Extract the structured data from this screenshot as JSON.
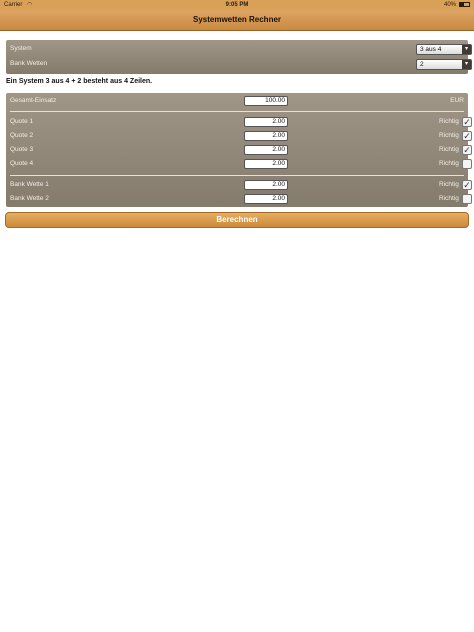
{
  "status_bar": {
    "carrier": "Carrier",
    "time": "9:05 PM",
    "battery": "40%",
    "battery_level": 0.4
  },
  "nav": {
    "title": "Systemwetten Rechner"
  },
  "settings": {
    "system_label": "System",
    "system_value": "3 aus 4",
    "bank_label": "Bank Wetten",
    "bank_value": "2"
  },
  "info_text": "Ein System 3 aus 4 + 2 besteht aus 4 Zeilen.",
  "stake": {
    "label": "Gesamt-Einsatz",
    "value": "100.00",
    "unit": "EUR"
  },
  "quotes": [
    {
      "label": "Quote 1",
      "value": "2.00",
      "richtig": "Richtig",
      "checked": true
    },
    {
      "label": "Quote 2",
      "value": "2.00",
      "richtig": "Richtig",
      "checked": true
    },
    {
      "label": "Quote 3",
      "value": "2.00",
      "richtig": "Richtig",
      "checked": true
    },
    {
      "label": "Quote 4",
      "value": "2.00",
      "richtig": "Richtig",
      "checked": false
    }
  ],
  "banks": [
    {
      "label": "Bank Wette 1",
      "value": "2.00",
      "richtig": "Richtig",
      "checked": true
    },
    {
      "label": "Bank Wette 2",
      "value": "2.00",
      "richtig": "Richtig",
      "checked": false
    }
  ],
  "button": {
    "calculate": "Berechnen"
  },
  "colors": {
    "accent": "#d9a058",
    "panel": "#948a7b"
  }
}
